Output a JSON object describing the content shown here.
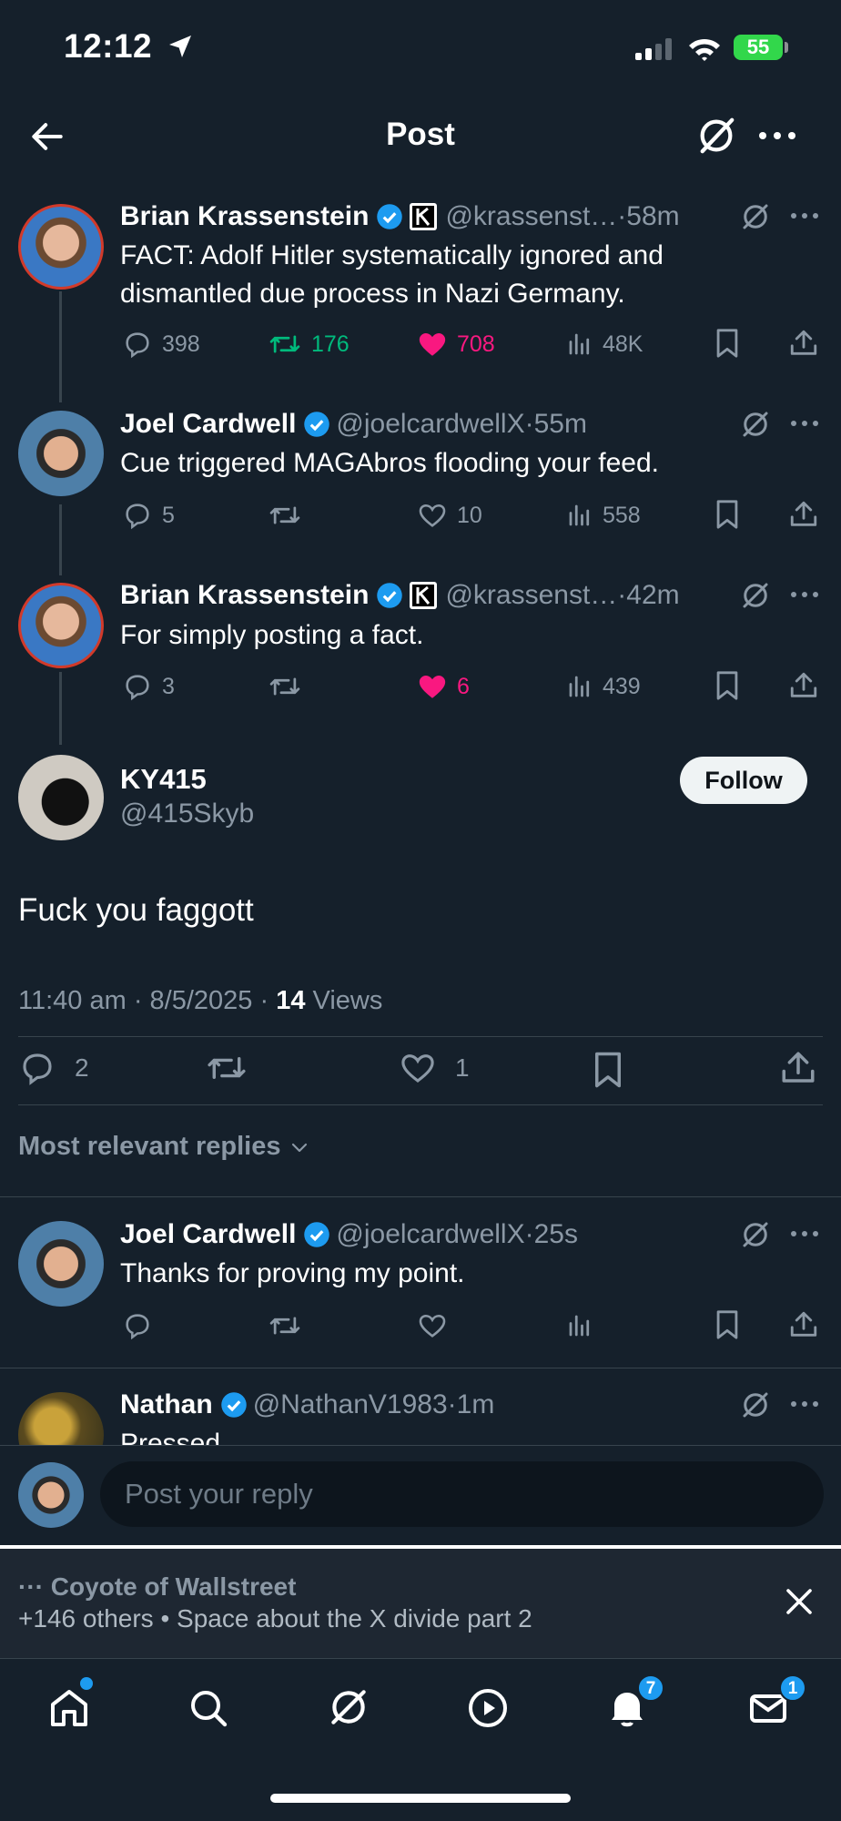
{
  "status_bar": {
    "time": "12:12",
    "battery": "55"
  },
  "header": {
    "title": "Post"
  },
  "thread": [
    {
      "name": "Brian Krassenstein",
      "handle": "@krassenst…",
      "time": "58m",
      "text": "FACT: Adolf Hitler systematically ignored and dismantled due process in Nazi Germany.",
      "replies": "398",
      "reposts": "176",
      "likes": "708",
      "views": "48K"
    },
    {
      "name": "Joel Cardwell",
      "handle": "@joelcardwellX",
      "time": "55m",
      "text": "Cue triggered MAGAbros flooding your feed.",
      "replies": "5",
      "reposts": "",
      "likes": "10",
      "views": "558"
    },
    {
      "name": "Brian Krassenstein",
      "handle": "@krassenst…",
      "time": "42m",
      "text": "For simply posting a fact.",
      "replies": "3",
      "reposts": "",
      "likes": "6",
      "views": "439"
    }
  ],
  "main_post": {
    "name": "KY415",
    "handle": "@415Skyb",
    "follow_label": "Follow",
    "text": "Fuck you faggott",
    "time": "11:40 am",
    "date": "8/5/2025",
    "views_count": "14",
    "views_label": "Views",
    "replies": "2",
    "likes": "1"
  },
  "sort_label": "Most relevant replies",
  "replies": [
    {
      "name": "Joel Cardwell",
      "handle": "@joelcardwellX",
      "time": "25s",
      "text": "Thanks for proving my point."
    },
    {
      "name": "Nathan",
      "handle": "@NathanV1983",
      "time": "1m",
      "text": "Pressed"
    }
  ],
  "reply_box": {
    "placeholder": "Post your reply"
  },
  "space": {
    "host": "Coyote of Wallstreet",
    "subtitle": "+146 others • Space about the X divide part 2"
  },
  "nav": {
    "notifications_badge": "7",
    "messages_badge": "1"
  },
  "colors": {
    "background": "#15202b",
    "accent": "#1d9bf0",
    "like": "#f91880",
    "repost": "#00ba7c",
    "muted": "#8b98a5"
  }
}
